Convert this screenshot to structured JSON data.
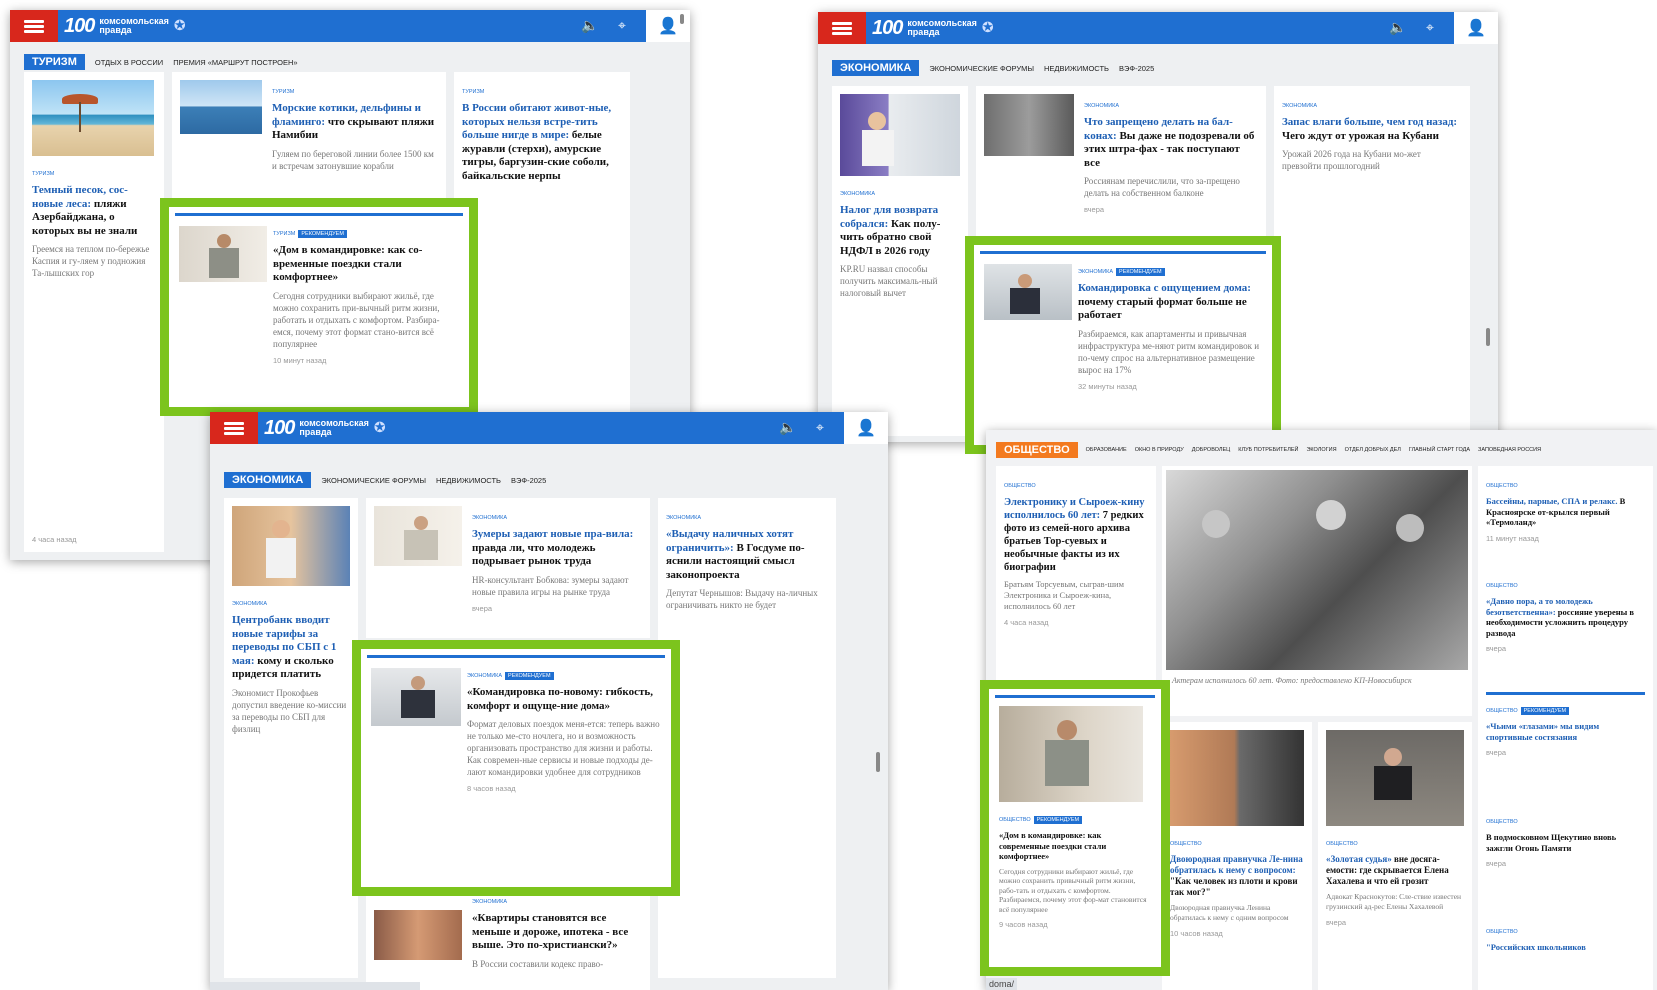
{
  "brand": {
    "logo_number": "100",
    "logo_text_line1": "Комсомольская",
    "logo_text_line2": "правда",
    "menu_icon": "hamburger-menu-icon",
    "sound_icon": "speaker-icon",
    "location_icon": "location-pin-icon",
    "user_icon": "user-profile-icon",
    "colors": {
      "header": "#1f6fd1",
      "menu": "#d8271c",
      "highlight": "#7cc41d",
      "link": "#1e5fb4",
      "section_orange": "#f37a1f"
    }
  },
  "w1": {
    "section": "ТУРИЗМ",
    "subnav": [
      "ОТДЫХ В РОССИИ",
      "ПРЕМИЯ «МАРШРУТ ПОСТРОЕН»"
    ],
    "left": {
      "tag": "ТУРИЗМ",
      "title_blue": "Темный песок, сос-новые леса:",
      "title_rest": " пляжи Азербайджана, о которых вы не знали",
      "lead": "Греемся на теплом по-бережье Каспия и гу-ляем у подножия Та-лышских гор",
      "time": "4 часа назад"
    },
    "mid": {
      "tag": "ТУРИЗМ",
      "title_blue": "Морские котики, дельфины и фламинго:",
      "title_rest": " что скрывают пляжи Намибии",
      "lead": "Гуляем по береговой линии более 1500 км и встречам затонувшие корабли"
    },
    "right": {
      "tag": "ТУРИЗМ",
      "title_blue": "В России обитают живот-ные, которых нельзя встре-тить больше нигде в мире:",
      "title_rest": " белые журавли (стерхи), амурские тигры, баргузин-ские соболи, байкальские нерпы"
    },
    "promo": {
      "tag": "ТУРИЗМ",
      "badge": "РЕКОМЕНДУЕМ",
      "title": "«Дом в командировке: как со-временные поездки стали комфортнее»",
      "lead": "Сегодня сотрудники выбирают жильё, где можно сохранить при-вычный ритм жизни, работать и отдыхать с комфортом. Разбира-емся, почему этот формат стано-вится всё популярнее",
      "time": "10 минут назад"
    }
  },
  "w2": {
    "section": "ЭКОНОМИКА",
    "subnav": [
      "ЭКОНОМИЧЕСКИЕ ФОРУМЫ",
      "НЕДВИЖИМОСТЬ",
      "ВЭФ-2025"
    ],
    "left": {
      "tag": "ЭКОНОМИКА",
      "title_blue": "Налог для возврата собрался:",
      "title_rest": " Как полу-чить обратно свой НДФЛ в 2026 году",
      "lead": "KP.RU назвал способы получить максималь-ный налоговый вычет"
    },
    "mid": {
      "tag": "ЭКОНОМИКА",
      "title_blue": "Что запрещено делать на бал-конах:",
      "title_rest": " Вы даже не подозревали об этих штра-фах - так поступают все",
      "lead": "Россиянам перечислили, что за-прещено делать на собственном балконе",
      "time": "вчера"
    },
    "right": {
      "tag": "ЭКОНОМИКА",
      "title_blue": "Запас влаги больше, чем год назад:",
      "title_rest": " Чего ждут от урожая на Кубани",
      "lead": "Урожай 2026 года на Кубани мо-жет превзойти прошлогодний"
    },
    "promo": {
      "tag": "ЭКОНОМИКА",
      "badge": "РЕКОМЕНДУЕМ",
      "title_blue": "Командировка с ощущением дома:",
      "title_rest": " почему старый формат больше не работает",
      "lead": "Разбираемся, как апартаменты и привычная инфраструктура ме-няют ритм командировок и по-чему спрос на альтернативное размещение вырос на 17%",
      "time": "32 минуты назад"
    }
  },
  "w3": {
    "section": "ЭКОНОМИКА",
    "subnav": [
      "ЭКОНОМИЧЕСКИЕ ФОРУМЫ",
      "НЕДВИЖИМОСТЬ",
      "ВЭФ-2025"
    ],
    "left": {
      "tag": "ЭКОНОМИКА",
      "title_blue": "Центробанк вводит новые тарифы за переводы по СБП с 1 мая:",
      "title_rest": " кому и сколько придется платить",
      "lead": "Экономист Прокофьев допустил введение ко-миссии за переводы по СБП для физлиц"
    },
    "mid": {
      "tag": "ЭКОНОМИКА",
      "title_blue": "Зумеры задают новые пра-вила:",
      "title_rest": " правда ли, что молодежь подрывает рынок труда",
      "lead": "HR-консультант Бобкова: зумеры задают новые правила игры на рынке труда",
      "time": "вчера"
    },
    "right": {
      "tag": "ЭКОНОМИКА",
      "title_blue": "«Выдачу наличных хотят ограничить»:",
      "title_rest": " В Госдуме по-яснили настоящий смысл законопроекта",
      "lead": "Депутат Чернышов: Выдачу на-личных ограничивать никто не будет"
    },
    "promo": {
      "tag": "ЭКОНОМИКА",
      "badge": "РЕКОМЕНДУЕМ",
      "title": "«Командировка по-новому: гибкость, комфорт и ощуще-ние дома»",
      "lead": "Формат деловых поездок меня-ется: теперь важно не только ме-сто ночлега, но и возможность организовать пространство для жизни и работы. Как современ-ные сервисы и новые подходы де-лают командировки удобнее для сотрудников",
      "time": "8 часов назад"
    },
    "bottom": {
      "tag": "ЭКОНОМИКА",
      "title": "«Квартиры становятся все меньше и дороже, ипотека - все выше. Это по-христиански?»",
      "lead": "В России составили кодекс право-"
    }
  },
  "w4": {
    "section": "ОБЩЕСТВО",
    "subnav": [
      "ОБРАЗОВАНИЕ",
      "ОКНО В ПРИРОДУ",
      "ДОБРОВОЛЕЦ",
      "КЛУБ ПОТРЕБИТЕЛЕЙ",
      "ЭКОЛОГИЯ",
      "ОТДЕЛ ДОБРЫХ ДЕЛ",
      "ГЛАВНЫЙ СТАРТ ГОДА",
      "ЗАПОВЕДНАЯ РОССИЯ"
    ],
    "left": {
      "tag": "ОБЩЕСТВО",
      "title_blue": "Электронику и Сыроеж-кину исполнилось 60 лет:",
      "title_rest": " 7 редких фото из семей-ного архива братьев Тор-суевых и необычные факты из их биографии",
      "lead": "Братьям Торсуевым, сыграв-шим Электроника и Сыроеж-кина, исполнилось 60 лет",
      "time": "4 часа назад"
    },
    "photo_caption": "Актерам исполнилось 60 лет. Фото: предоставлено КП-Новосибирск",
    "right": [
      {
        "tag": "ОБЩЕСТВО",
        "title_blue": "Бассейны, парные, СПА и релакс.",
        "title_rest": " В Красноярске от-крылся первый «Термоланд»",
        "time": "11 минут назад"
      },
      {
        "tag": "ОБЩЕСТВО",
        "title_blue": "«Давно пора, а то молодежь безответственна»:",
        "title_rest": " россияне уверены в необходимости усложнить процедуру развода",
        "time": "вчера"
      },
      {
        "tag": "ОБЩЕСТВО",
        "badge": "РЕКОМЕНДУЕМ",
        "title_blue": "«Чьими «глазами» мы видим спортивные состязания",
        "title_rest": "",
        "time": "вчера"
      },
      {
        "tag": "ОБЩЕСТВО",
        "title_blue": "",
        "title_rest": "В подмосковном Щекутино вновь зажгли Огонь Памяти",
        "time": "вчера"
      },
      {
        "tag": "ОБЩЕСТВО",
        "title_blue": "\"Российских школьников",
        "title_rest": ""
      }
    ],
    "promo": {
      "tag": "ОБЩЕСТВО",
      "badge": "РЕКОМЕНДУЕМ",
      "title": "«Дом в командировке: как современные поездки стали комфортнее»",
      "lead": "Сегодня сотрудники выбирают жильё, где можно сохранить привычный ритм жизни, рабо-тать и отдыхать с комфортом. Разбираемся, почему этот фор-мат становится всё популярнее",
      "time": "9 часов назад"
    },
    "mid2": {
      "tag": "ОБЩЕСТВО",
      "title_blue": "Двоюродная правнучка Ле-нина обратилась к нему с вопросом:",
      "title_rest": " \"Как человек из плоти и крови так мог?\"",
      "lead": "Двоюродная правнучка Ленина обратилась к нему с одним вопросом",
      "time": "10 часов назад"
    },
    "mid3": {
      "tag": "ОБЩЕСТВО",
      "title_blue": "«Золотая судья»",
      "title_rest": " вне досяга-емости: где скрывается Елена Хахалева и что ей грозит",
      "lead": "Адвокат Краснокутов: Сле-ствие известен грузинский ад-рес Елены Хахалевой",
      "time": "вчера"
    },
    "url_fragment": "doma/"
  }
}
